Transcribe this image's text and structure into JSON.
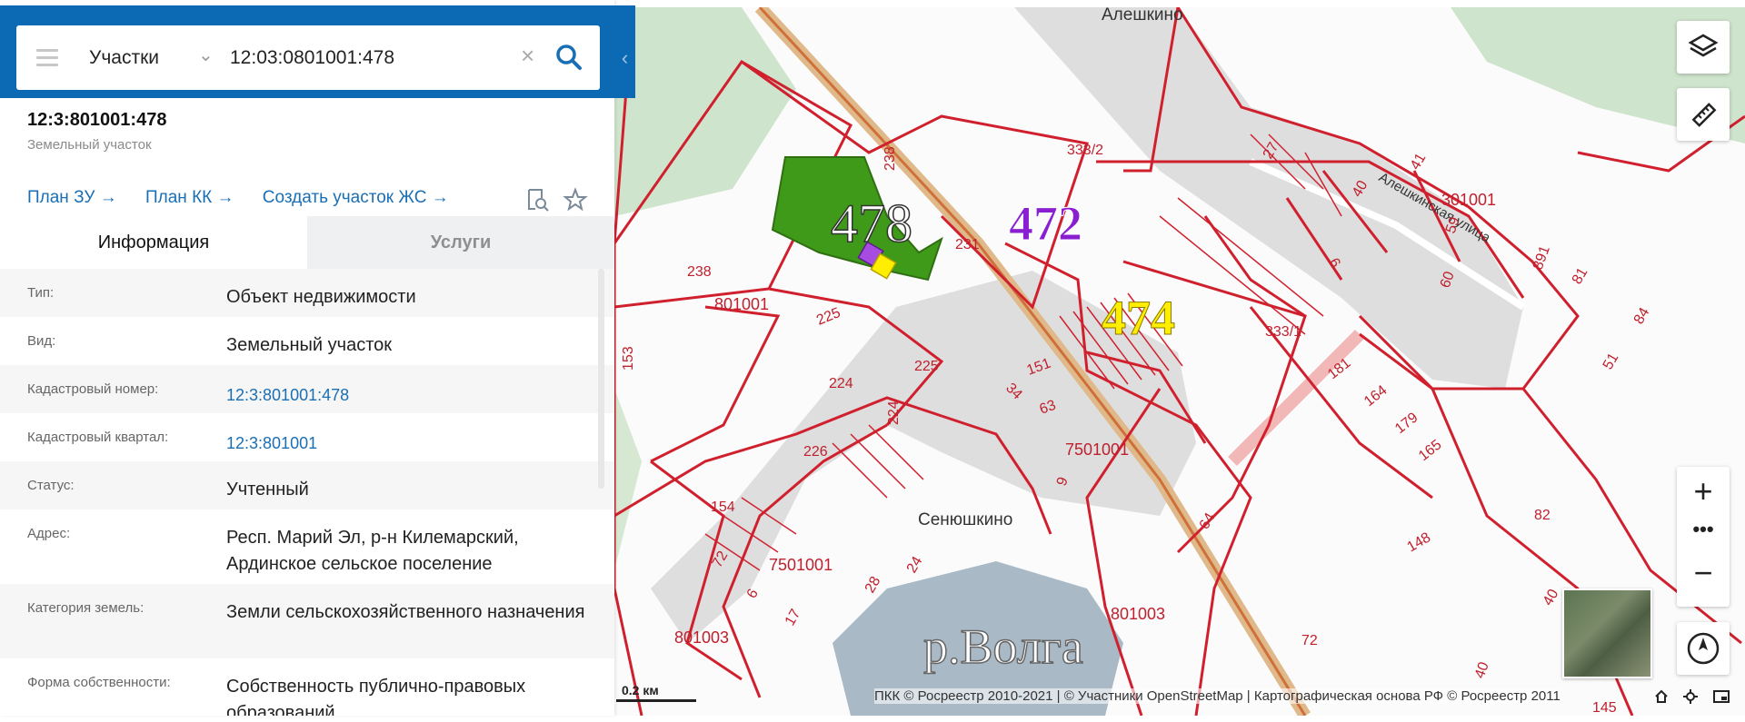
{
  "search": {
    "select_value": "Участки",
    "query": "12:03:0801001:478"
  },
  "panel": {
    "title": "12:3:801001:478",
    "subtitle": "Земельный участок",
    "links": [
      "План ЗУ →",
      "План КК →",
      "Создать участок ЖС →"
    ],
    "tabs": [
      "Информация",
      "Услуги"
    ],
    "rows": [
      {
        "label": "Тип:",
        "value": "Объект недвижимости"
      },
      {
        "label": "Вид:",
        "value": "Земельный участок"
      },
      {
        "label": "Кадастровый номер:",
        "value": "12:3:801001:478"
      },
      {
        "label": "Кадастровый квартал:",
        "value": "12:3:801001"
      },
      {
        "label": "Статус:",
        "value": "Учтенный"
      },
      {
        "label": "Адрес:",
        "value": "Респ. Марий Эл, р-н Килемарский, Ардинское сельское поселение"
      },
      {
        "label": "Категория земель:",
        "value": "Земли сельскохозяйственного назначения"
      },
      {
        "label": "Форма собственности:",
        "value": "Собственность публично-правовых образований"
      }
    ]
  },
  "map": {
    "highlights": {
      "parcel_478": "478",
      "parcel_472": "472",
      "parcel_474": "474"
    },
    "places": {
      "aleshkino": "Алешкино",
      "senyushkino": "Сенюшкино",
      "street": "Алешкинская улица",
      "river": "р.Волга"
    },
    "parcel_labels": [
      "238",
      "231",
      "333/2",
      "238",
      "801001",
      "225",
      "225",
      "224",
      "224",
      "226",
      "153",
      "151",
      "34",
      "63",
      "9",
      "7501001",
      "154",
      "72",
      "6",
      "17",
      "28",
      "24",
      "7501001",
      "801003",
      "801003",
      "64",
      "72",
      "40",
      "333/1",
      "181",
      "164",
      "179",
      "165",
      "301001",
      "27",
      "41",
      "40",
      "59",
      "6",
      "60",
      "891",
      "81",
      "84",
      "51",
      "79",
      "82",
      "148",
      "145",
      "145",
      "40"
    ],
    "scale_label": "0.2 км",
    "attribution": "ПКК © Росреестр 2010-2021 | © Участники OpenStreetMap | Картографическая основа РФ © Росреестр 2011"
  },
  "colors": {
    "brand_blue": "#0b6ab3",
    "link_blue": "#1a6fb4",
    "parcel_green": "#3f9a1a",
    "label_472": "#8a1fd1",
    "label_474": "#ffee00",
    "boundary_red": "#d0202e",
    "water": "#a9b9c6"
  }
}
